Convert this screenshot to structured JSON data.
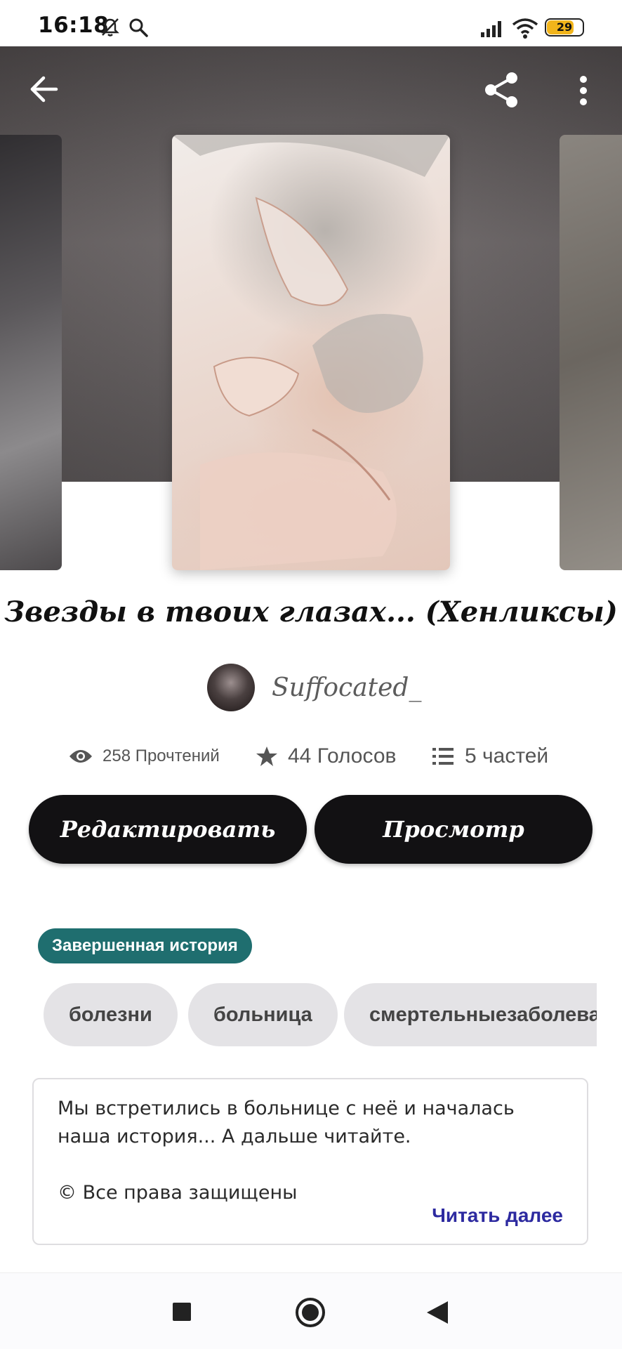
{
  "status_bar": {
    "time": "16:18",
    "battery": "29",
    "icons": [
      "mute-bell-icon",
      "search-icon",
      "signal-icon",
      "wifi-icon",
      "battery-icon"
    ]
  },
  "top_bar": {
    "icons": [
      "back-arrow-icon",
      "share-icon",
      "more-vert-icon"
    ]
  },
  "story": {
    "title": "Звезды в твоих глазах... (Хенликсы)",
    "author": "Suffocated_",
    "reads": "258 Прочтений",
    "votes": "44 Голосов",
    "parts": "5 частей"
  },
  "actions": {
    "edit_label": "Редактировать",
    "view_label": "Просмотр"
  },
  "status_badge": "Завершенная история",
  "tags": [
    "болезни",
    "больница",
    "смертельныезаболевания"
  ],
  "description": {
    "text": "Мы встретились в больнице с неё и началась наша история... А дальше читайте.\n\n© Все права защищены",
    "read_more": "Читать далее"
  },
  "colors": {
    "button_bg": "#121113",
    "badge_bg": "#1f6e6f",
    "link": "#2d2aa0",
    "tag_bg": "#e4e3e6"
  }
}
